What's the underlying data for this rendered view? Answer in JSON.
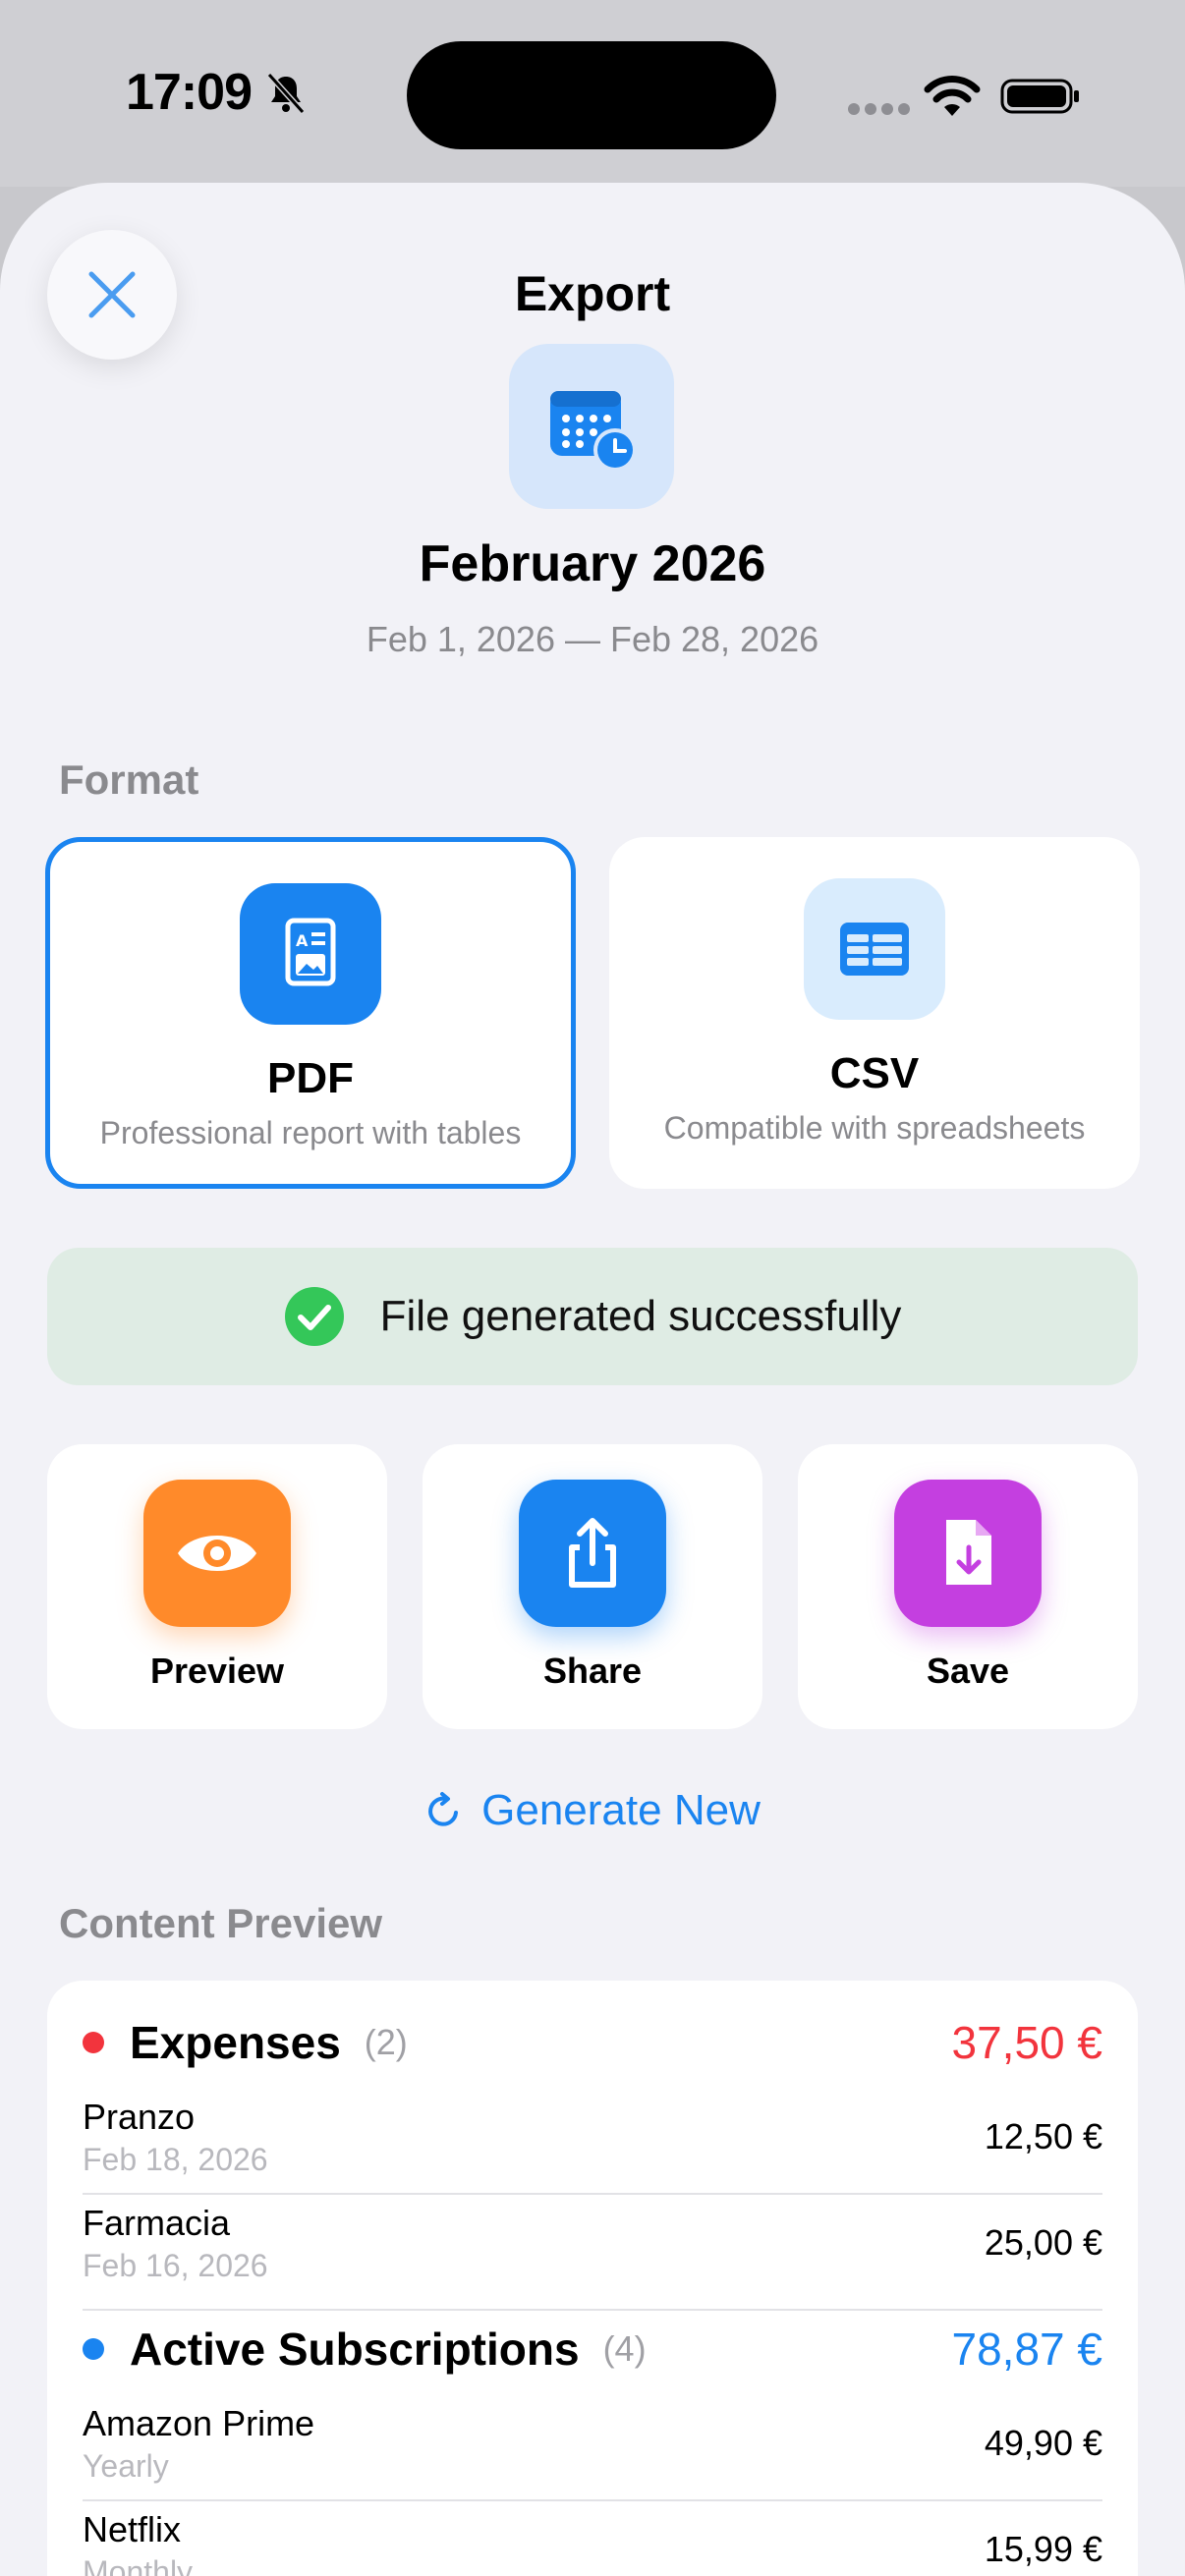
{
  "status_bar": {
    "time": "17:09"
  },
  "sheet": {
    "title": "Export"
  },
  "period": {
    "title": "February 2026",
    "range": "Feb 1, 2026 — Feb 28, 2026"
  },
  "format": {
    "label": "Format",
    "options": [
      {
        "name": "PDF",
        "description": "Professional report with tables",
        "selected": true
      },
      {
        "name": "CSV",
        "description": "Compatible with spreadsheets",
        "selected": false
      }
    ]
  },
  "status": {
    "message": "File generated successfully"
  },
  "actions": [
    {
      "label": "Preview",
      "icon": "eye-icon",
      "color": "#ff8a2a"
    },
    {
      "label": "Share",
      "icon": "share-icon",
      "color": "#1a84f0"
    },
    {
      "label": "Save",
      "icon": "save-file-icon",
      "color": "#c43fe0"
    }
  ],
  "generate_new": {
    "label": "Generate New"
  },
  "content_preview": {
    "label": "Content Preview",
    "groups": [
      {
        "title": "Expenses",
        "count": "(2)",
        "total": "37,50 €",
        "color": "#f2343d",
        "rows": [
          {
            "name": "Pranzo",
            "sub": "Feb 18, 2026",
            "amount": "12,50 €"
          },
          {
            "name": "Farmacia",
            "sub": "Feb 16, 2026",
            "amount": "25,00 €"
          }
        ]
      },
      {
        "title": "Active Subscriptions",
        "count": "(4)",
        "total": "78,87 €",
        "color": "#1a84f0",
        "rows": [
          {
            "name": "Amazon Prime",
            "sub": "Yearly",
            "amount": "49,90 €"
          },
          {
            "name": "Netflix",
            "sub": "Monthly",
            "amount": "15,99 €"
          }
        ]
      }
    ]
  },
  "colors": {
    "accent": "#1a84f0",
    "success": "#34c759",
    "danger": "#f2343d"
  }
}
